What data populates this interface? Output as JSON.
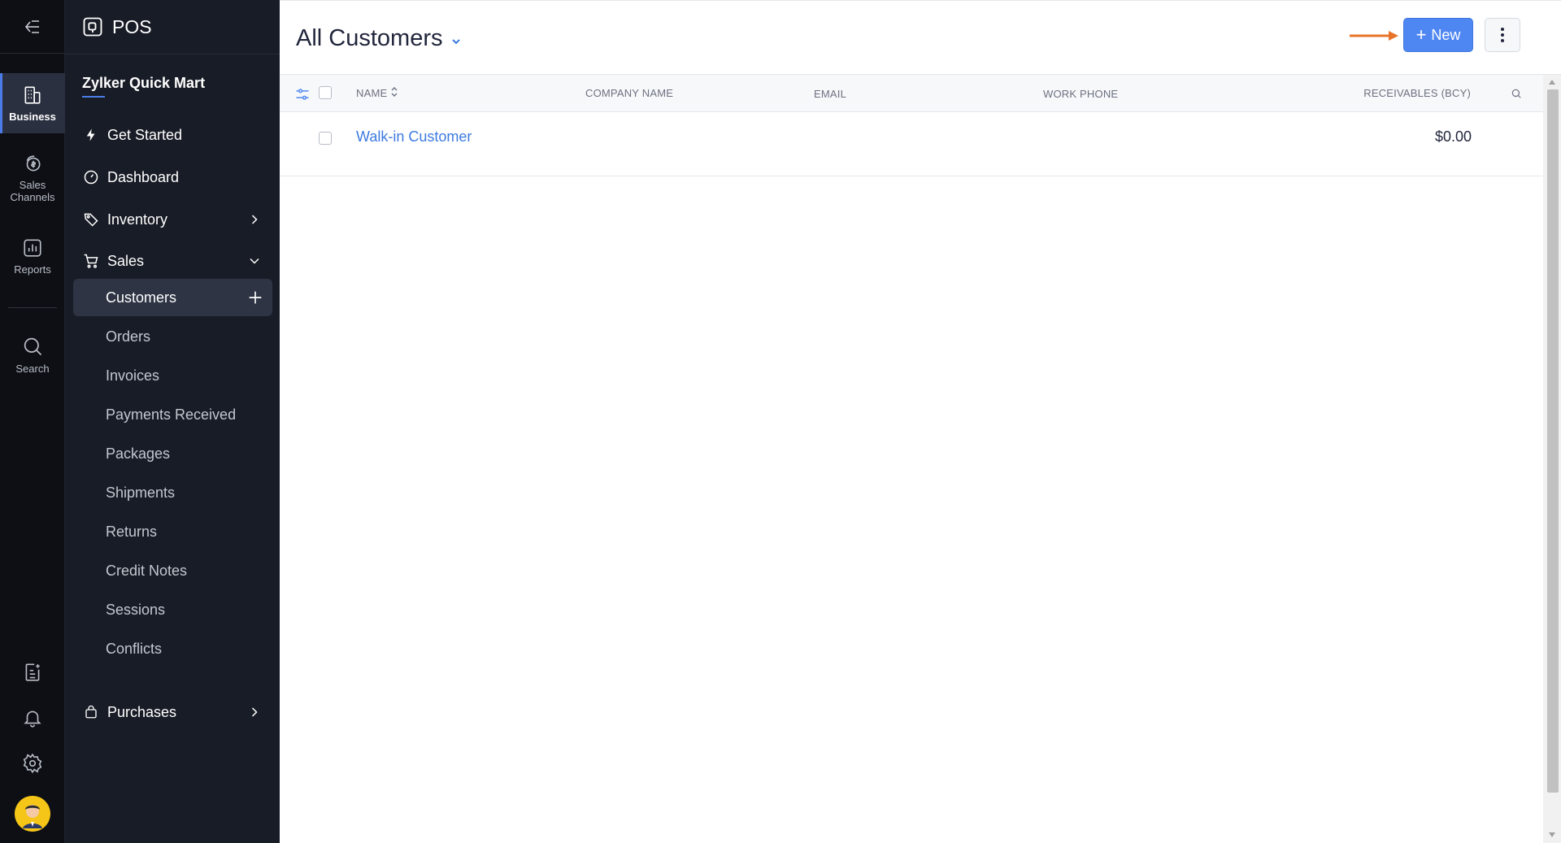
{
  "rail": {
    "items": [
      {
        "label": "Business"
      },
      {
        "label": "Sales Channels"
      },
      {
        "label": "Reports"
      },
      {
        "label": "Search"
      }
    ]
  },
  "sidebar": {
    "app_title": "POS",
    "org_name": "Zylker Quick Mart",
    "nav": {
      "get_started": "Get Started",
      "dashboard": "Dashboard",
      "inventory": "Inventory",
      "sales": "Sales",
      "purchases": "Purchases"
    },
    "sales_items": [
      "Customers",
      "Orders",
      "Invoices",
      "Payments Received",
      "Packages",
      "Shipments",
      "Returns",
      "Credit Notes",
      "Sessions",
      "Conflicts"
    ]
  },
  "main": {
    "title": "All Customers",
    "new_button": "New",
    "columns": {
      "name": "NAME",
      "company": "COMPANY NAME",
      "email": "EMAIL",
      "phone": "WORK PHONE",
      "receivables": "RECEIVABLES (BCY)"
    },
    "rows": [
      {
        "name": "Walk-in Customer",
        "company": "",
        "email": "",
        "phone": "",
        "receivables": "$0.00"
      }
    ]
  },
  "colors": {
    "accent": "#4f87f2",
    "link": "#3d7be0",
    "sidebar_bg": "#181c26",
    "rail_bg": "#0d0f14",
    "annotation_arrow": "#e8742a"
  }
}
